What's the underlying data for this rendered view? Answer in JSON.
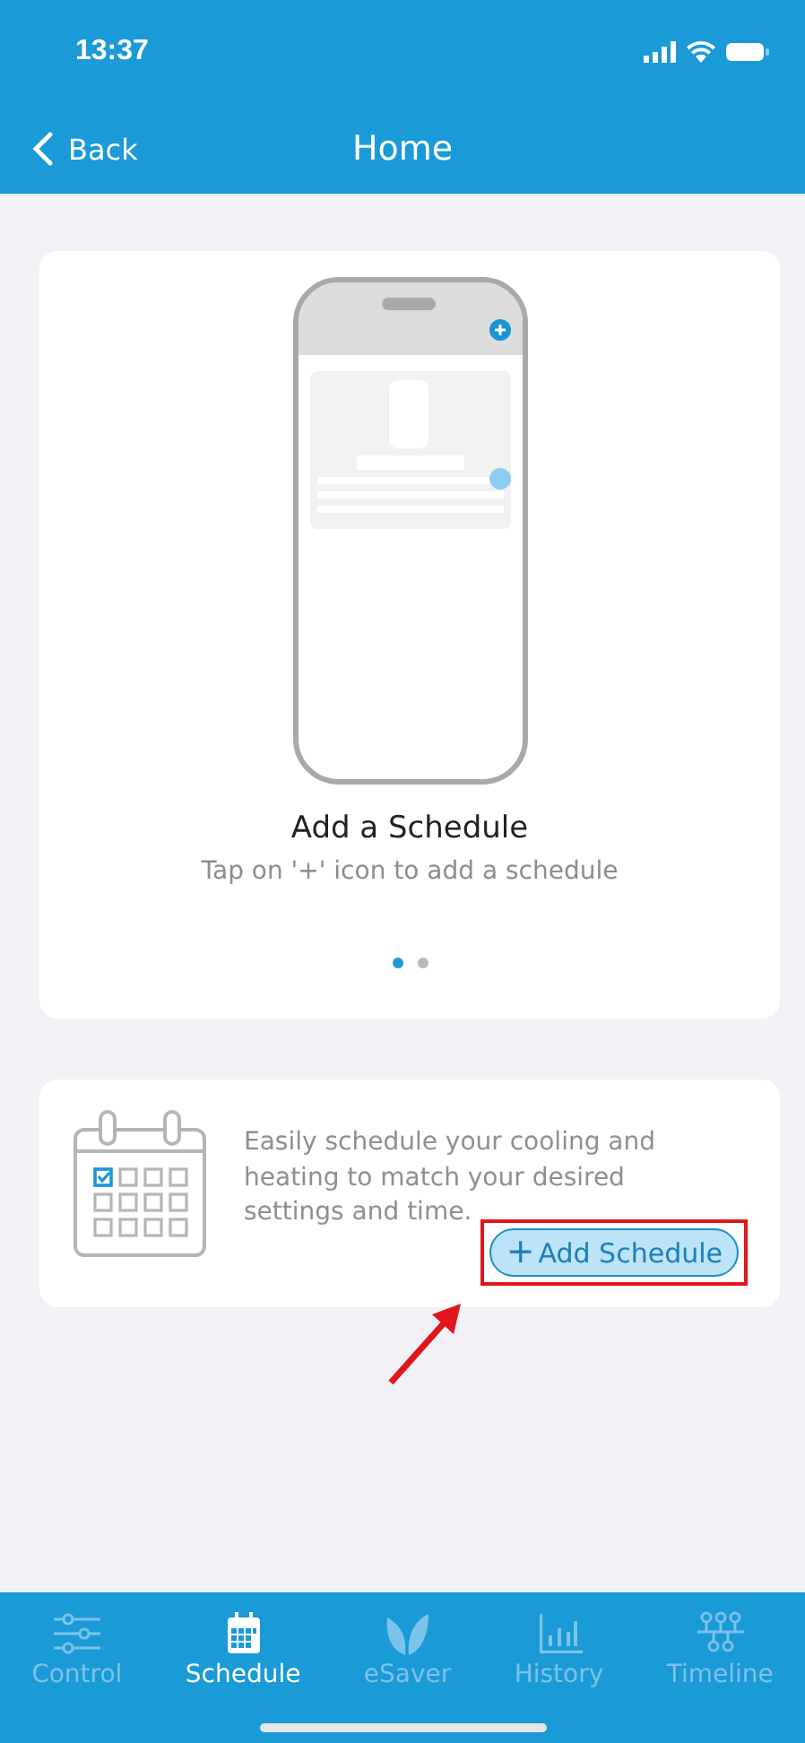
{
  "status_bar": {
    "time": "13:37"
  },
  "nav": {
    "back": "Back",
    "title": "Home"
  },
  "intro_card": {
    "title": "Add a Schedule",
    "subtitle": "Tap on '+' icon to add a schedule",
    "pages": [
      {
        "selected": true
      },
      {
        "selected": false
      }
    ]
  },
  "info_card": {
    "text": "Easily schedule your cooling and heating to match your desired settings and time.",
    "button": {
      "icon": "+",
      "label": "Add Schedule",
      "highlighted": true
    }
  },
  "tabs": [
    {
      "label": "Control",
      "selected": false
    },
    {
      "label": "Schedule",
      "selected": true
    },
    {
      "label": "eSaver",
      "selected": false
    },
    {
      "label": "History",
      "selected": false
    },
    {
      "label": "Timeline",
      "selected": false
    }
  ]
}
